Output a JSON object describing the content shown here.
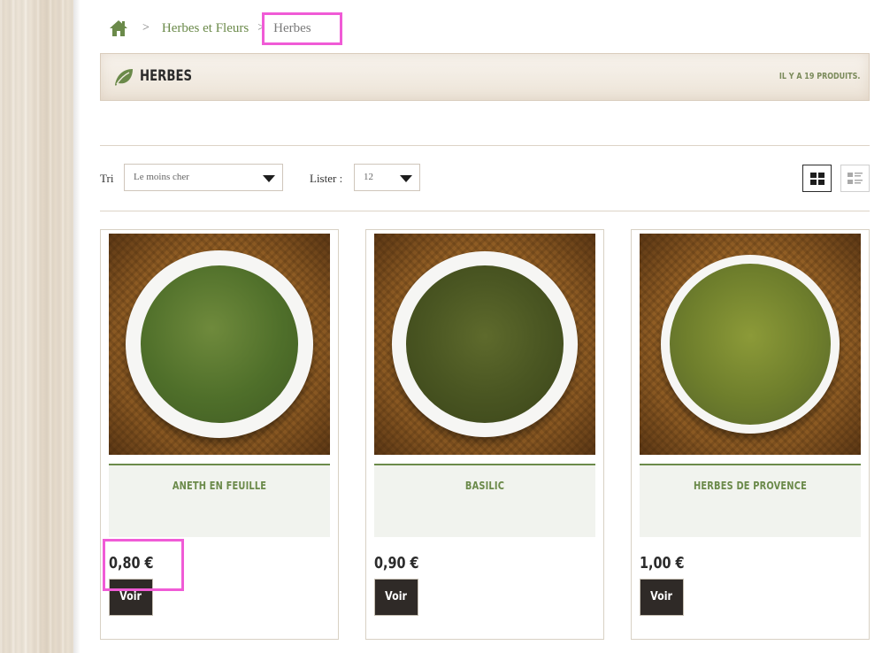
{
  "breadcrumb": {
    "separator": ">",
    "parent": "Herbes et Fleurs",
    "current": "Herbes"
  },
  "category": {
    "title": "HERBES",
    "count_text": "IL Y A 19 PRODUITS."
  },
  "sort": {
    "label": "Tri",
    "value": "Le moins cher"
  },
  "per_page": {
    "label": "Lister :",
    "value": "12"
  },
  "products": [
    {
      "name": "ANETH EN FEUILLE",
      "price": "0,80 €",
      "button": "Voir"
    },
    {
      "name": "BASILIC",
      "price": "0,90 €",
      "button": "Voir"
    },
    {
      "name": "HERBES DE PROVENCE",
      "price": "1,00 €",
      "button": "Voir"
    }
  ],
  "colors": {
    "accent_green": "#6b8a4a",
    "highlight": "#f05bd6",
    "button_dark": "#2f2a27"
  }
}
